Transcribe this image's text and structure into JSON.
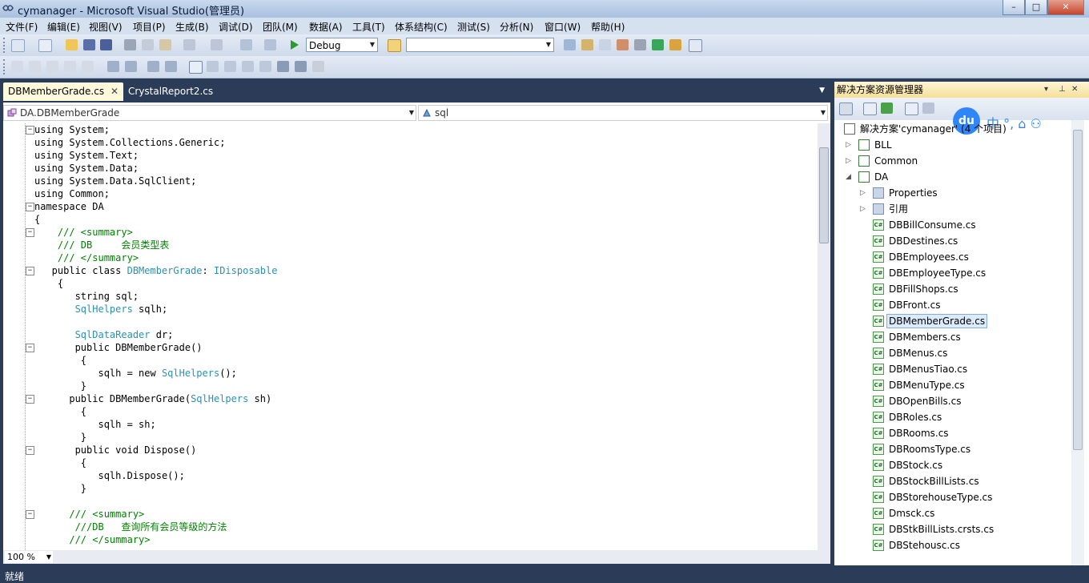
{
  "window": {
    "title": "cymanager - Microsoft Visual Studio(管理员)",
    "min": "–",
    "max": "□",
    "close": "✕"
  },
  "menu": [
    "文件(F)",
    "编辑(E)",
    "视图(V)",
    "项目(P)",
    "生成(B)",
    "调试(D)",
    "团队(M)",
    "数据(A)",
    "工具(T)",
    "体系结构(C)",
    "测试(S)",
    "分析(N)",
    "窗口(W)",
    "帮助(H)"
  ],
  "toolbar": {
    "config": "Debug",
    "platform": ""
  },
  "tabs": [
    {
      "label": "DBMemberGrade.cs",
      "active": true
    },
    {
      "label": "CrystalReport2.cs",
      "active": false
    }
  ],
  "nav": {
    "class_combo": "DA.DBMemberGrade",
    "member_combo": "sql"
  },
  "code_lines": [
    [
      {
        "t": "using System;",
        "c": "kw1"
      }
    ],
    [
      {
        "t": "using System.Collections.Generic;",
        "c": "kw1"
      }
    ],
    [
      {
        "t": "using System.Text;",
        "c": "kw1"
      }
    ],
    [
      {
        "t": "using System.Data;",
        "c": "kw1"
      }
    ],
    [
      {
        "t": "using System.Data.SqlClient;",
        "c": "kw1"
      }
    ],
    [
      {
        "t": "using Common;",
        "c": "kw1"
      }
    ],
    [
      {
        "t": "namespace DA",
        "c": "kw1"
      }
    ],
    [
      {
        "t": "{",
        "c": ""
      }
    ],
    [
      {
        "t": "    /// <summary>",
        "c": "cm"
      }
    ],
    [
      {
        "t": "    /// DB     会员类型表",
        "c": "cm"
      }
    ],
    [
      {
        "t": "    /// </summary>",
        "c": "cm"
      }
    ],
    [
      {
        "t": "   public class ",
        "c": ""
      },
      {
        "t": "DBMemberGrade",
        "c": "ty"
      },
      {
        "t": ": ",
        "c": ""
      },
      {
        "t": "IDisposable",
        "c": "ty"
      }
    ],
    [
      {
        "t": "    {",
        "c": ""
      }
    ],
    [
      {
        "t": "       string sql;",
        "c": ""
      }
    ],
    [
      {
        "t": "       ",
        "c": ""
      },
      {
        "t": "SqlHelpers",
        "c": "ty"
      },
      {
        "t": " sqlh;",
        "c": ""
      }
    ],
    [
      {
        "t": "",
        "c": ""
      }
    ],
    [
      {
        "t": "       ",
        "c": ""
      },
      {
        "t": "SqlDataReader",
        "c": "ty"
      },
      {
        "t": " dr;",
        "c": ""
      }
    ],
    [
      {
        "t": "       public DBMemberGrade()",
        "c": ""
      }
    ],
    [
      {
        "t": "        {",
        "c": ""
      }
    ],
    [
      {
        "t": "           sqlh = new ",
        "c": ""
      },
      {
        "t": "SqlHelpers",
        "c": "ty"
      },
      {
        "t": "();",
        "c": ""
      }
    ],
    [
      {
        "t": "        }",
        "c": ""
      }
    ],
    [
      {
        "t": "      public DBMemberGrade(",
        "c": ""
      },
      {
        "t": "SqlHelpers",
        "c": "ty"
      },
      {
        "t": " sh)",
        "c": ""
      }
    ],
    [
      {
        "t": "        {",
        "c": ""
      }
    ],
    [
      {
        "t": "           sqlh = sh;",
        "c": ""
      }
    ],
    [
      {
        "t": "        }",
        "c": ""
      }
    ],
    [
      {
        "t": "       public void Dispose()",
        "c": ""
      }
    ],
    [
      {
        "t": "        {",
        "c": ""
      }
    ],
    [
      {
        "t": "           sqlh.Dispose();",
        "c": ""
      }
    ],
    [
      {
        "t": "        }",
        "c": ""
      }
    ],
    [
      {
        "t": "",
        "c": ""
      }
    ],
    [
      {
        "t": "      /// <summary>",
        "c": "cm"
      }
    ],
    [
      {
        "t": "       ///DB   查询所有会员等级的方法",
        "c": "cm"
      }
    ],
    [
      {
        "t": "      /// </summary>",
        "c": "cm"
      }
    ]
  ],
  "zoom": "100 %",
  "status": "就绪",
  "solution_explorer": {
    "title": "解决方案资源管理器",
    "solution": "解决方案'cymanager' (4 个项目)",
    "projects": [
      "BLL",
      "Common",
      "DA"
    ],
    "da_children": [
      "Properties",
      "引用"
    ],
    "files": [
      "DBBillConsume.cs",
      "DBDestines.cs",
      "DBEmployees.cs",
      "DBEmployeeType.cs",
      "DBFillShops.cs",
      "DBFront.cs",
      "DBMemberGrade.cs",
      "DBMembers.cs",
      "DBMenus.cs",
      "DBMenusTiao.cs",
      "DBMenuType.cs",
      "DBOpenBills.cs",
      "DBRoles.cs",
      "DBRooms.cs",
      "DBRoomsType.cs",
      "DBStock.cs",
      "DBStockBillLists.cs",
      "DBStorehouseType.cs",
      "Dmsck.cs",
      "DBStkBillLists.crsts.cs",
      "DBStehousc.cs"
    ],
    "selected_file": "DBMemberGrade.cs"
  },
  "ime": {
    "logo": "du",
    "icons": "中 °, ⌂ ⚇"
  }
}
